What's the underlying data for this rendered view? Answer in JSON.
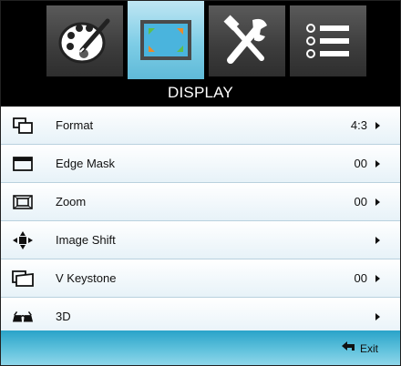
{
  "tabs": [
    {
      "icon": "palette-icon",
      "active": false
    },
    {
      "icon": "display-icon",
      "active": true
    },
    {
      "icon": "tools-icon",
      "active": false
    },
    {
      "icon": "list-icon",
      "active": false
    }
  ],
  "title": "DISPLAY",
  "menu": [
    {
      "icon": "format-icon",
      "label": "Format",
      "value": "4:3",
      "has_arrow": true
    },
    {
      "icon": "edge-mask-icon",
      "label": "Edge Mask",
      "value": "00",
      "has_arrow": true
    },
    {
      "icon": "zoom-icon",
      "label": "Zoom",
      "value": "00",
      "has_arrow": true
    },
    {
      "icon": "image-shift-icon",
      "label": "Image Shift",
      "value": "",
      "has_arrow": true
    },
    {
      "icon": "v-keystone-icon",
      "label": "V Keystone",
      "value": "00",
      "has_arrow": true
    },
    {
      "icon": "3d-glasses-icon",
      "label": "3D",
      "value": "",
      "has_arrow": true
    }
  ],
  "footer": {
    "exit_label": "Exit",
    "exit_icon": "back-arrow-icon"
  },
  "colors": {
    "active_tab": "#7ecde6",
    "footer": "#5fc1dc",
    "title_bar": "#000000"
  }
}
